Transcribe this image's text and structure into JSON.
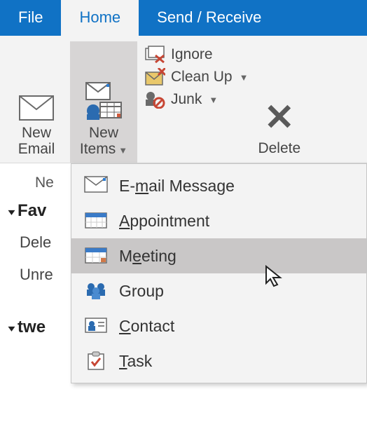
{
  "tabs": {
    "file": "File",
    "home": "Home",
    "sendreceive": "Send / Receive"
  },
  "ribbon": {
    "new_email_l1": "New",
    "new_email_l2": "Email",
    "new_items_l1": "New",
    "new_items_l2": "Items",
    "ignore": "Ignore",
    "cleanup": "Clean Up",
    "junk": "Junk",
    "delete": "Delete"
  },
  "nav": {
    "small": "Ne",
    "favorites": "Fav",
    "deleted": "Dele",
    "unread": "Unre",
    "twe": "twe"
  },
  "dropdown": {
    "email_pre": "E-",
    "email_u": "m",
    "email_post": "ail Message",
    "appt_u": "A",
    "appt_post": "ppointment",
    "meeting_pre": "M",
    "meeting_u": "e",
    "meeting_post": "eting",
    "group": "Group",
    "contact_u": "C",
    "contact_post": "ontact",
    "task_u": "T",
    "task_post": "ask"
  }
}
